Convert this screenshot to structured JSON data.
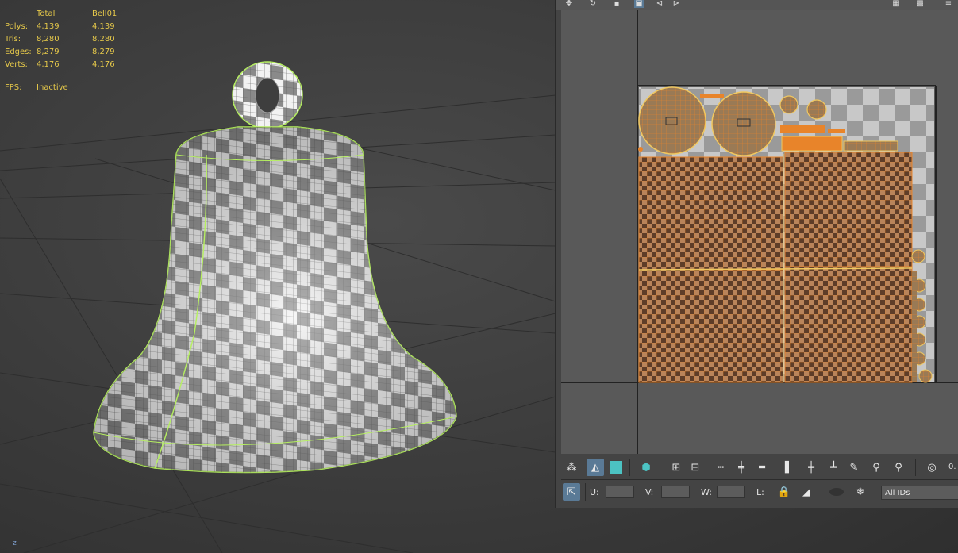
{
  "stats": {
    "header": {
      "label": "",
      "total": "Total",
      "object": "Bell01"
    },
    "rows": [
      {
        "label": "Polys:",
        "total": "4,139",
        "object": "4,139"
      },
      {
        "label": "Tris:",
        "total": "8,280",
        "object": "8,280"
      },
      {
        "label": "Edges:",
        "total": "8,279",
        "object": "8,279"
      },
      {
        "label": "Verts:",
        "total": "4,176",
        "object": "4,176"
      }
    ],
    "fps_label": "FPS:",
    "fps_value": "Inactive"
  },
  "viewport": {
    "axis_label": "z",
    "object_name": "Bell01",
    "selection_color": "#b6f060"
  },
  "uv_editor": {
    "accent_color": "#e8842a",
    "toolbar1_icons": [
      "move-vertex-icon",
      "select-poly-icon",
      "select-element-icon",
      "cube-icon",
      "grow-select-icon",
      "shrink-select-icon",
      "loop-icon",
      "ring-icon",
      "edge-sel-icon",
      "align-v-icon",
      "align-v2-icon",
      "align-h-icon",
      "brush-icon",
      "pin-icon",
      "pin2-icon",
      "settings-ring-icon"
    ],
    "partial_value": "0.",
    "u_label": "U:",
    "v_label": "V:",
    "w_label": "W:",
    "l_label": "L:",
    "ids_value": "All IDs"
  }
}
